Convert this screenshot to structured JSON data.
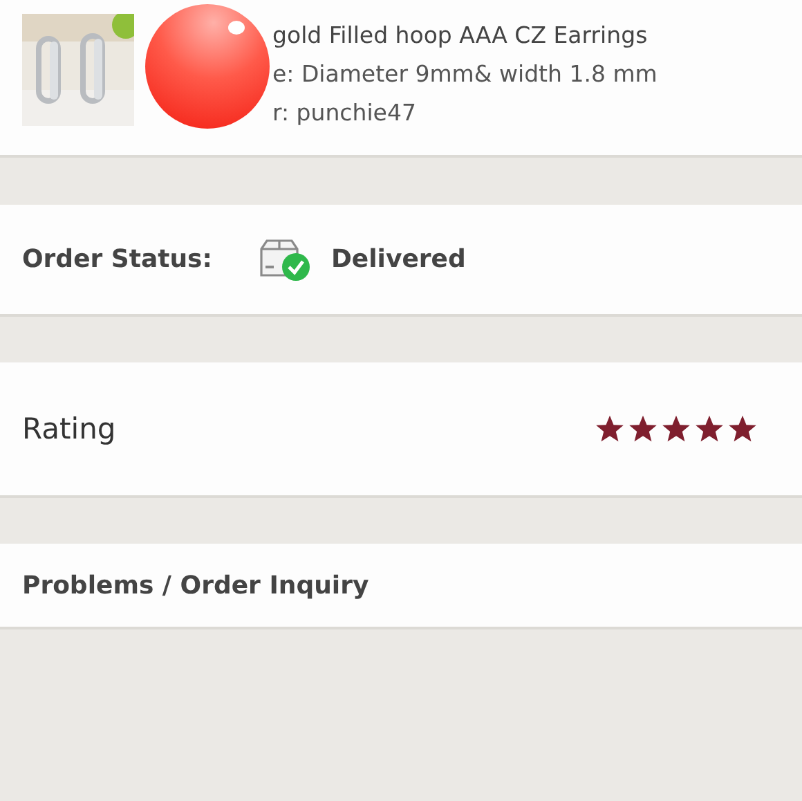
{
  "item": {
    "lines": [
      "gold Filled hoop AAA CZ Earrings",
      "e: Diameter 9mm& width 1.8 mm",
      "r: punchie47"
    ]
  },
  "order_status": {
    "label": "Order Status:",
    "value": "Delivered"
  },
  "rating": {
    "label": "Rating",
    "stars": 5
  },
  "inquiry": {
    "label": "Problems / Order Inquiry"
  }
}
